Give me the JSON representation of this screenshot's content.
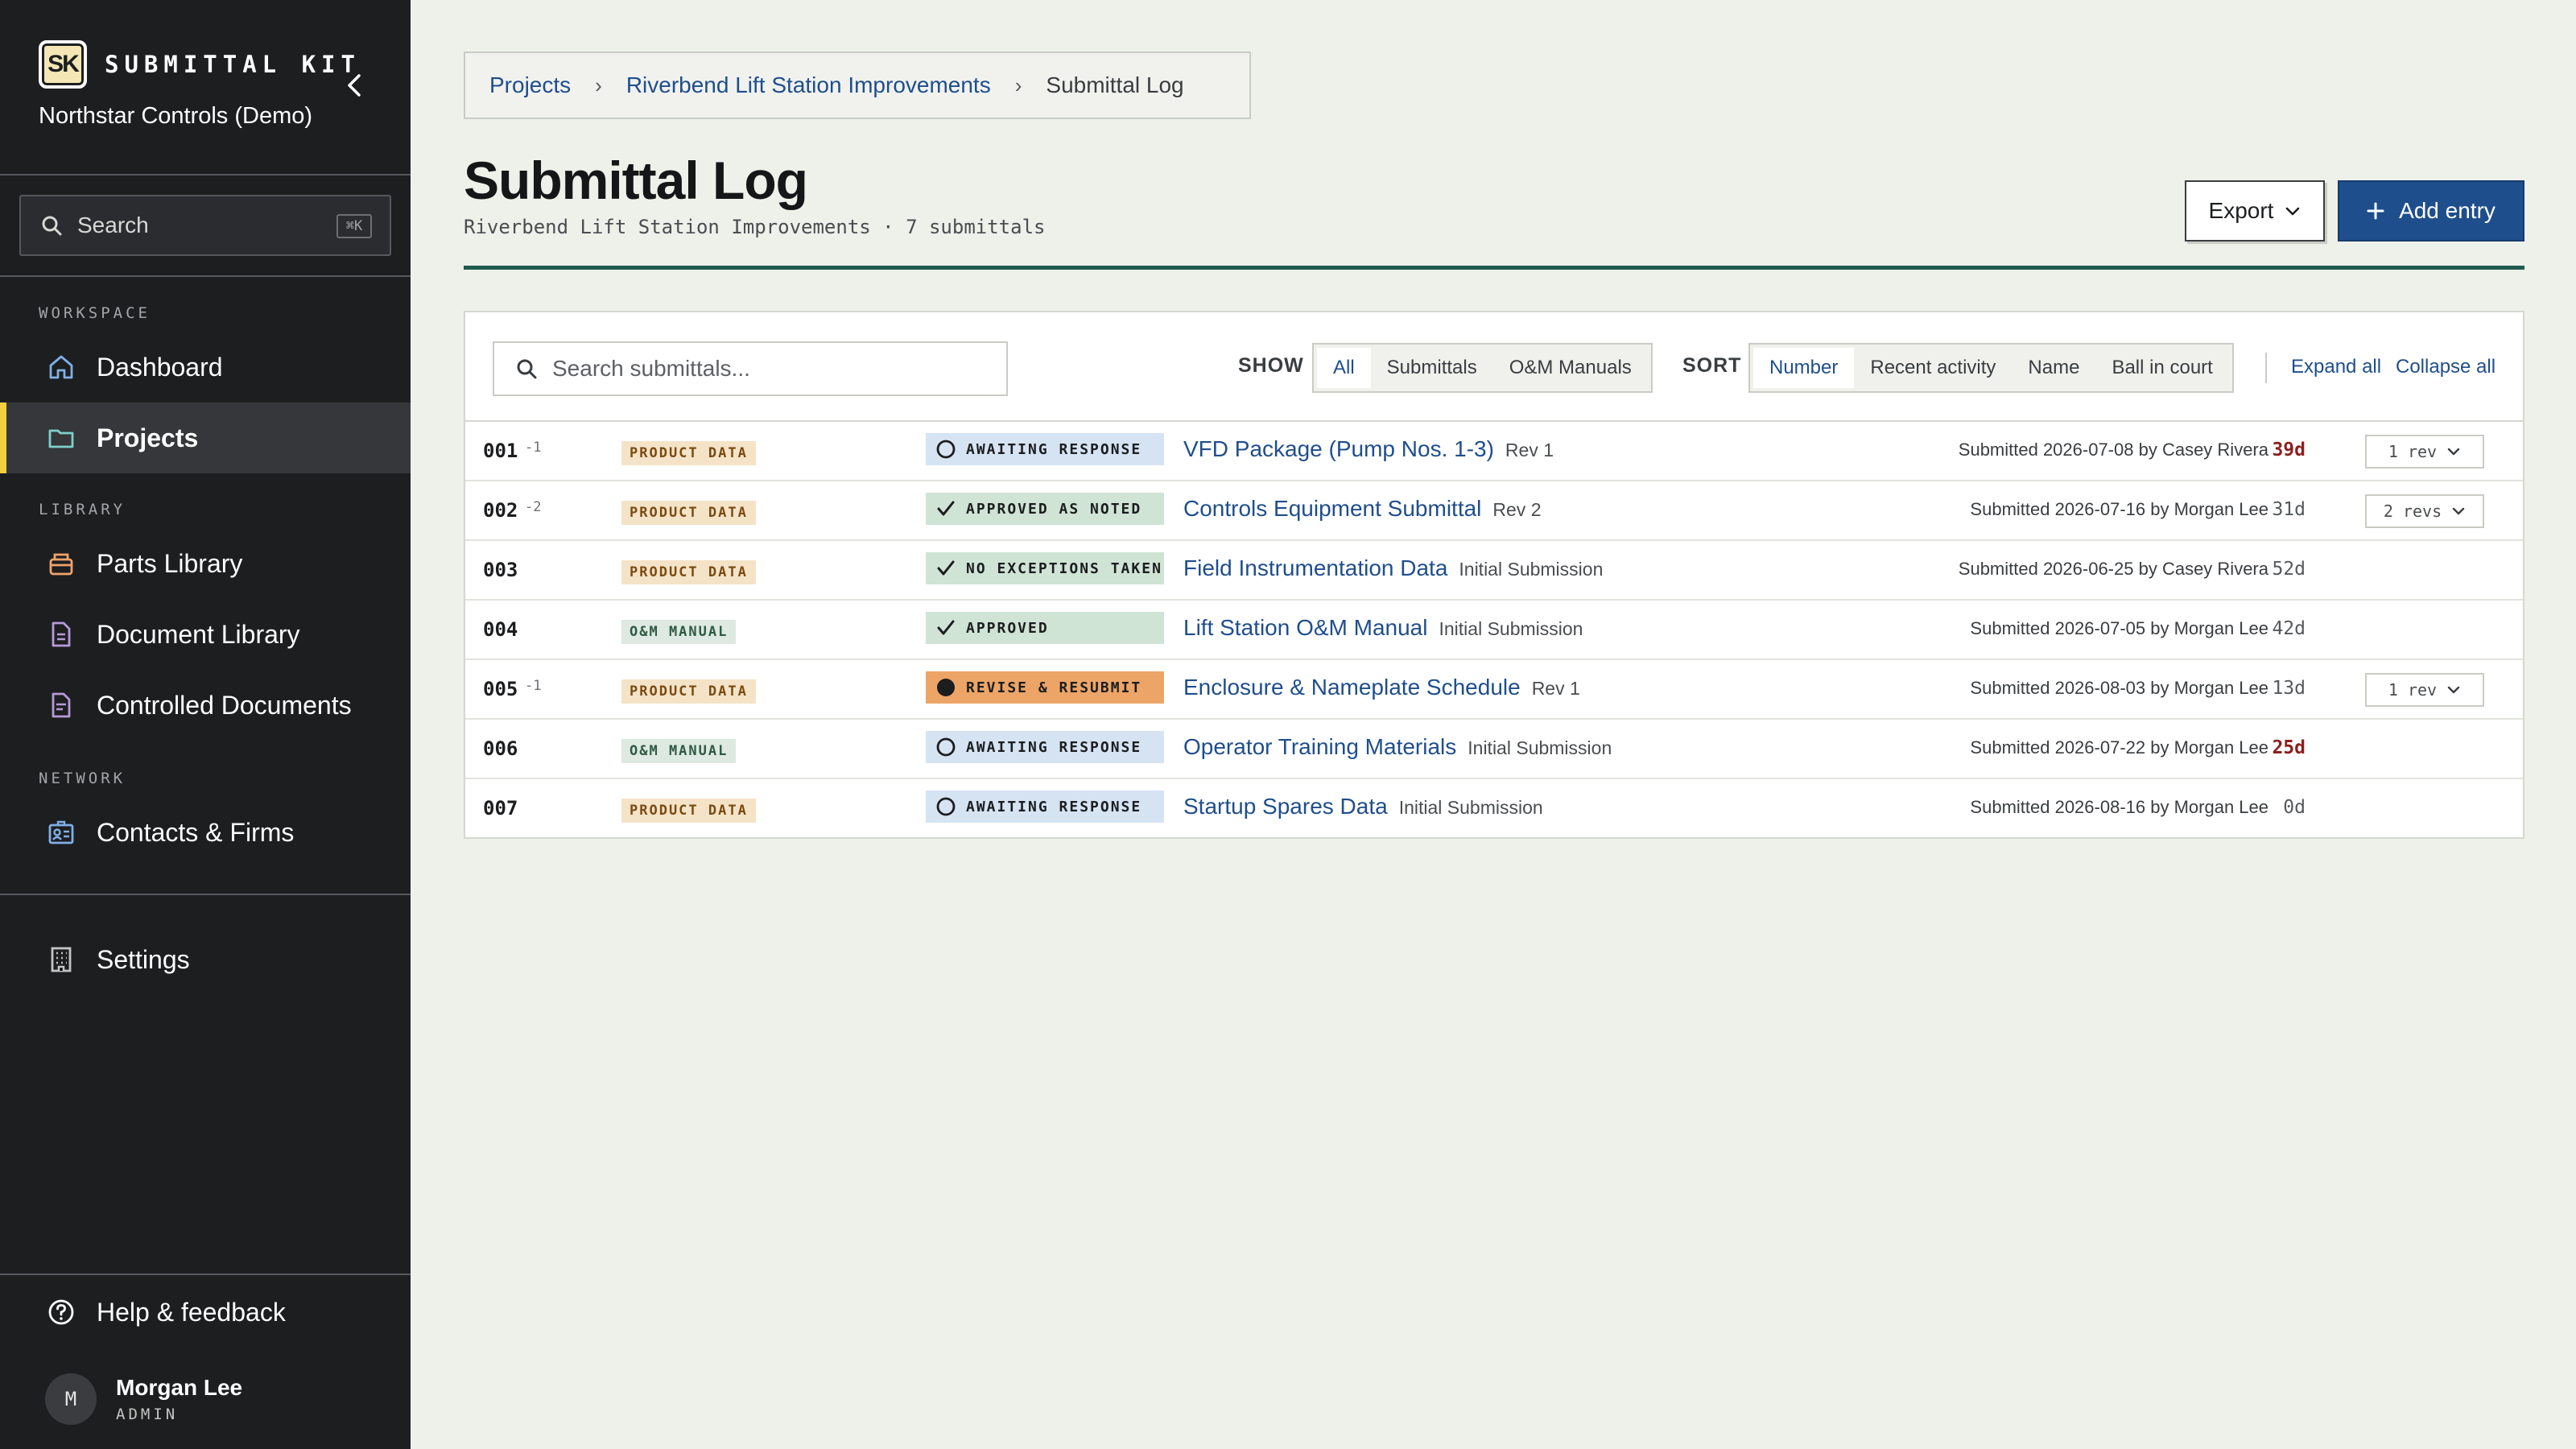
{
  "app": {
    "brand_mark": "SK",
    "brand_name": "SUBMITTAL KIT",
    "org_name": "Northstar Controls (Demo)"
  },
  "sidebar": {
    "search_label": "Search",
    "search_shortcut": "⌘K",
    "sections": {
      "workspace": "WORKSPACE",
      "library": "LIBRARY",
      "network": "NETWORK"
    },
    "items": [
      {
        "label": "Dashboard",
        "icon": "home-icon"
      },
      {
        "label": "Projects",
        "icon": "folder-icon",
        "active": true
      },
      {
        "label": "Parts Library",
        "icon": "package-icon"
      },
      {
        "label": "Document Library",
        "icon": "document-icon"
      },
      {
        "label": "Controlled Documents",
        "icon": "controlled-doc-icon"
      },
      {
        "label": "Contacts & Firms",
        "icon": "contact-card-icon"
      },
      {
        "label": "Settings",
        "icon": "building-icon"
      }
    ],
    "help_label": "Help & feedback",
    "user": {
      "initial": "M",
      "name": "Morgan Lee",
      "role": "ADMIN"
    }
  },
  "breadcrumb": {
    "items": [
      "Projects",
      "Riverbend Lift Station Improvements",
      "Submittal Log"
    ],
    "separator": "›"
  },
  "header": {
    "title": "Submittal Log",
    "subtitle": "Riverbend Lift Station Improvements · 7 submittals",
    "export_label": "Export",
    "add_label": "Add entry",
    "accent_color": "#1f5a4e",
    "primary_color": "#1f4e8c"
  },
  "toolbar": {
    "search_placeholder": "Search submittals...",
    "show_label": "SHOW",
    "show_options": [
      "All",
      "Submittals",
      "O&M Manuals"
    ],
    "show_selected": "All",
    "sort_label": "SORT",
    "sort_options": [
      "Number",
      "Recent activity",
      "Name",
      "Ball in court"
    ],
    "sort_selected": "Number",
    "expand_all": "Expand all",
    "collapse_all": "Collapse all"
  },
  "submittals": [
    {
      "number": "001",
      "rev_marker": "-1",
      "type": "PRODUCT DATA",
      "type_kind": "product",
      "status": "AWAITING RESPONSE",
      "status_kind": "await",
      "title": "VFD Package (Pump Nos. 1-3)",
      "revision": "Rev 1",
      "meta": "Submitted 2026-07-08 by Casey Rivera",
      "age": "39d",
      "age_late": true,
      "revs": "1 rev"
    },
    {
      "number": "002",
      "rev_marker": "-2",
      "type": "PRODUCT DATA",
      "type_kind": "product",
      "status": "APPROVED AS NOTED",
      "status_kind": "approved",
      "title": "Controls Equipment Submittal",
      "revision": "Rev 2",
      "meta": "Submitted 2026-07-16 by Morgan Lee",
      "age": "31d",
      "age_late": false,
      "revs": "2 revs"
    },
    {
      "number": "003",
      "rev_marker": "",
      "type": "PRODUCT DATA",
      "type_kind": "product",
      "status": "NO EXCEPTIONS TAKEN",
      "status_kind": "approved",
      "title": "Field Instrumentation Data",
      "revision": "Initial Submission",
      "meta": "Submitted 2026-06-25 by Casey Rivera",
      "age": "52d",
      "age_late": false,
      "revs": ""
    },
    {
      "number": "004",
      "rev_marker": "",
      "type": "O&M MANUAL",
      "type_kind": "om",
      "status": "APPROVED",
      "status_kind": "approved",
      "title": "Lift Station O&M Manual",
      "revision": "Initial Submission",
      "meta": "Submitted 2026-07-05 by Morgan Lee",
      "age": "42d",
      "age_late": false,
      "revs": ""
    },
    {
      "number": "005",
      "rev_marker": "-1",
      "type": "PRODUCT DATA",
      "type_kind": "product",
      "status": "REVISE & RESUBMIT",
      "status_kind": "revise",
      "title": "Enclosure & Nameplate Schedule",
      "revision": "Rev 1",
      "meta": "Submitted 2026-08-03 by Morgan Lee",
      "age": "13d",
      "age_late": false,
      "revs": "1 rev"
    },
    {
      "number": "006",
      "rev_marker": "",
      "type": "O&M MANUAL",
      "type_kind": "om",
      "status": "AWAITING RESPONSE",
      "status_kind": "await",
      "title": "Operator Training Materials",
      "revision": "Initial Submission",
      "meta": "Submitted 2026-07-22 by Morgan Lee",
      "age": "25d",
      "age_late": true,
      "revs": ""
    },
    {
      "number": "007",
      "rev_marker": "",
      "type": "PRODUCT DATA",
      "type_kind": "product",
      "status": "AWAITING RESPONSE",
      "status_kind": "await",
      "title": "Startup Spares Data",
      "revision": "Initial Submission",
      "meta": "Submitted 2026-08-16 by Morgan Lee",
      "age": "0d",
      "age_late": false,
      "revs": ""
    }
  ]
}
